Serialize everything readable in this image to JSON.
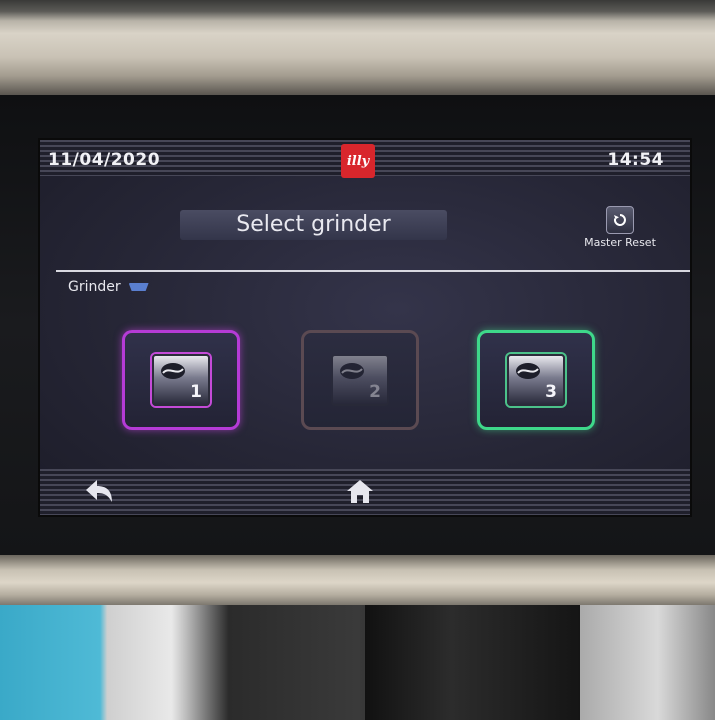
{
  "header": {
    "date": "11/04/2020",
    "time": "14:54",
    "brand_logo": "illy"
  },
  "title": "Select grinder",
  "master_reset": {
    "label": "Master Reset",
    "icon": "reset-icon"
  },
  "section": {
    "label": "Grinder"
  },
  "grinders": [
    {
      "number": "1",
      "icon": "coffee-bean-icon",
      "state": "selected",
      "color": "#b53bd6"
    },
    {
      "number": "2",
      "icon": "coffee-bean-icon",
      "state": "disabled",
      "color": "#5b4a52"
    },
    {
      "number": "3",
      "icon": "coffee-bean-icon",
      "state": "active",
      "color": "#3ed88a"
    }
  ],
  "footer": {
    "back_icon": "back-arrow-icon",
    "home_icon": "home-icon"
  },
  "colors": {
    "brand_red": "#d8262c",
    "screen_bg": "#262636",
    "text": "#f1f1f5"
  }
}
